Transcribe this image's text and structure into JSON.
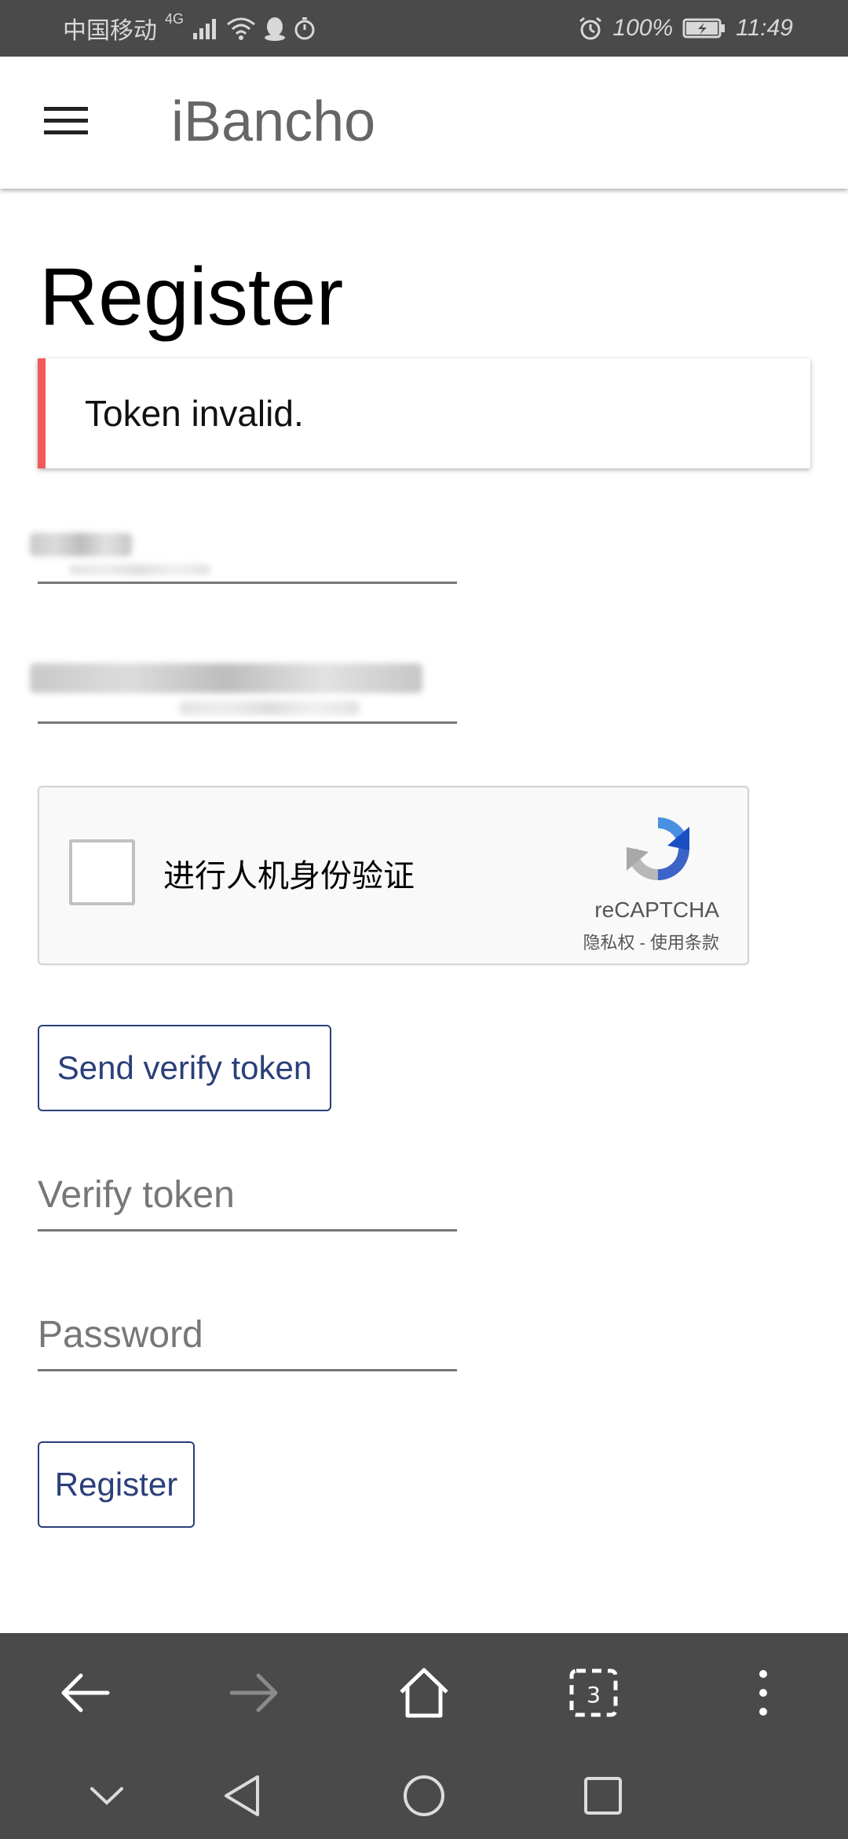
{
  "status_bar": {
    "carrier": "中国移动",
    "network": "4G",
    "battery": "100%",
    "time": "11:49"
  },
  "app_bar": {
    "title": "iBancho"
  },
  "page": {
    "title": "Register",
    "alert_message": "Token invalid."
  },
  "form": {
    "verify_token_placeholder": "Verify token",
    "password_placeholder": "Password",
    "send_token_label": "Send verify token",
    "register_label": "Register"
  },
  "captcha": {
    "label": "进行人机身份验证",
    "brand": "reCAPTCHA",
    "links": "隐私权 - 使用条款"
  },
  "colors": {
    "alert_border": "#f25a5a",
    "button_text": "#2b3f7a",
    "toolbar_bg": "#4a4a4a"
  }
}
